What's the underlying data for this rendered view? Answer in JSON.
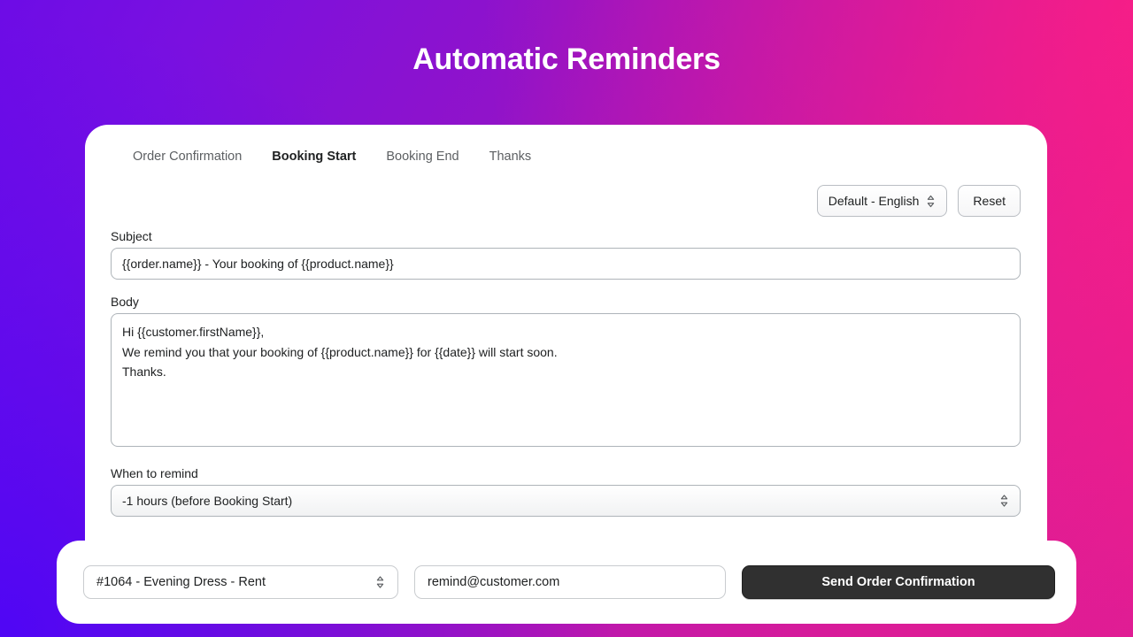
{
  "page": {
    "title": "Automatic Reminders",
    "background_from": "#6d0ce6",
    "background_to": "#fb2180"
  },
  "tabs": [
    {
      "label": "Order Confirmation",
      "active": false
    },
    {
      "label": "Booking Start",
      "active": true
    },
    {
      "label": "Booking End",
      "active": false
    },
    {
      "label": "Thanks",
      "active": false
    }
  ],
  "toolbar": {
    "language_value": "Default - English",
    "reset_label": "Reset",
    "chevron_icon": "chevron-up-down-icon"
  },
  "form": {
    "subject_label": "Subject",
    "subject_value": "{{order.name}} - Your booking of {{product.name}}",
    "body_label": "Body",
    "body_value": "Hi {{customer.firstName}},\nWe remind you that your booking of {{product.name}} for {{date}} will start soon.\nThanks.",
    "remind_label": "When to remind",
    "remind_value": "-1 hours (before Booking Start)"
  },
  "bottom_bar": {
    "order_value": "#1064 - Evening Dress - Rent",
    "email_value": "remind@customer.com",
    "send_label": "Send Order Confirmation",
    "send_button_color": "#303030"
  }
}
